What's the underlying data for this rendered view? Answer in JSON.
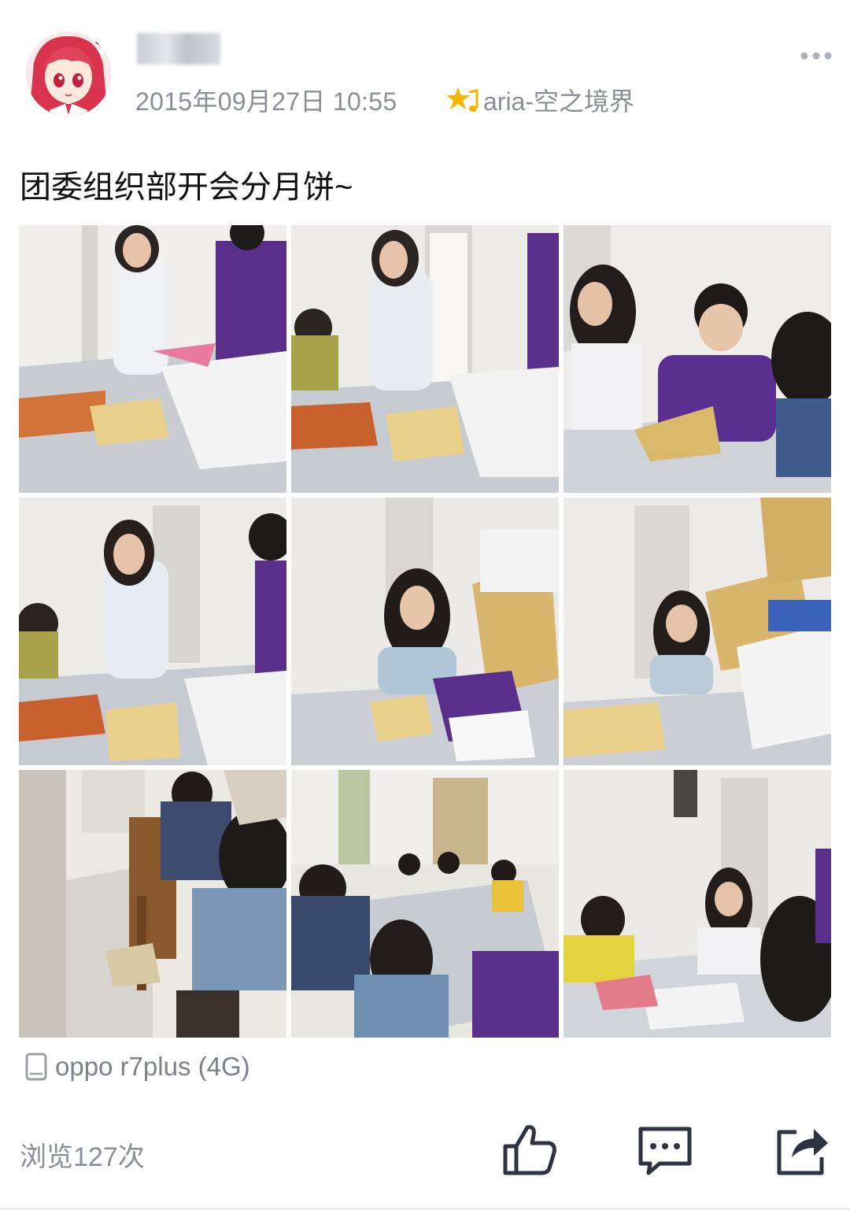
{
  "post": {
    "timestamp": "2015年09月27日 10:55",
    "source": "aria-空之境界",
    "text": "团委组织部开会分月饼~",
    "device": "oppo r7plus (4G)",
    "views": "浏览127次",
    "photo_count": 9
  },
  "icons": {
    "source": "star-music-icon",
    "more": "more-dots-icon",
    "device": "phone-icon",
    "like": "thumbs-up-icon",
    "comment": "comment-bubble-icon",
    "share": "share-arrow-icon"
  },
  "colors": {
    "meta_text": "#8a8e99",
    "icon": "#2d3340",
    "star": "#f5b400"
  }
}
